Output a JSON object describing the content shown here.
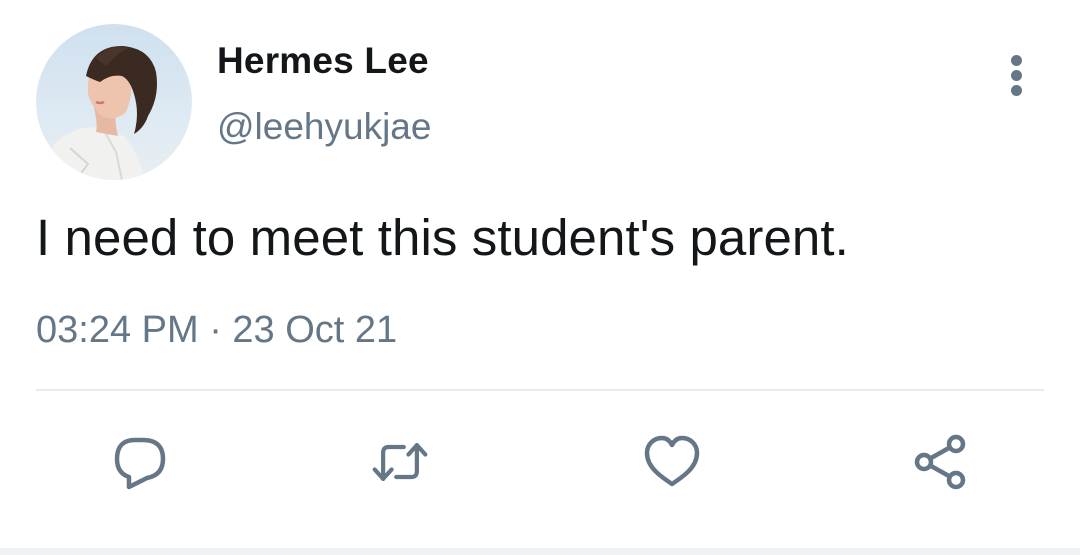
{
  "tweet": {
    "display_name": "Hermes Lee",
    "handle": "@leehyukjae",
    "text": "I need to meet this student's parent.",
    "timestamp": "03:24 PM · 23 Oct 21"
  },
  "icons": {
    "more": "more-vertical-icon",
    "reply": "reply-icon",
    "retweet": "retweet-icon",
    "like": "heart-icon",
    "share": "share-icon"
  },
  "colors": {
    "text_primary": "#14171a",
    "text_secondary": "#657786",
    "divider": "#e6ecf0"
  }
}
